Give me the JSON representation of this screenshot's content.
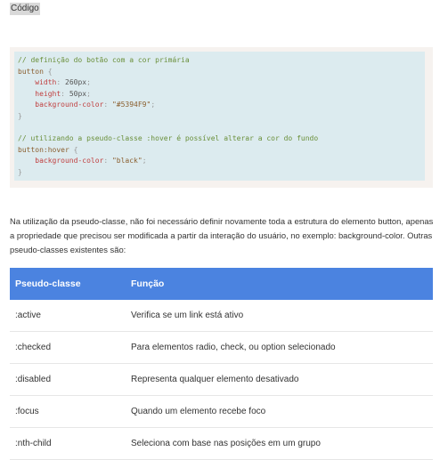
{
  "heading": "Código",
  "code": {
    "line1_comment": "// definição do botão com a cor primária",
    "line2_selector": "button",
    "line2_brace": " {",
    "line3_prop": "width",
    "line3_value": "260px",
    "line4_prop": "height",
    "line4_value": "50px",
    "line5_prop": "background-color",
    "line5_value": "\"#5394F9\"",
    "line6_close": "}",
    "line8_comment": "// utilizando a pseudo-classe :hover é possível alterar a cor do fundo",
    "line9_selector": "button:hover",
    "line9_brace": " {",
    "line10_prop": "background-color",
    "line10_value": "\"black\"",
    "line11_close": "}"
  },
  "paragraph": "Na utilização da pseudo-classe, não foi necessário definir novamente toda a estrutura do elemento button, apenas a propriedade que precisou ser modificada a partir da interação do usuário, no exemplo: background-color. Outras pseudo-classes existentes são:",
  "table": {
    "headers": [
      "Pseudo-classe",
      "Função"
    ],
    "rows": [
      [
        ":active",
        "Verifica se um link está ativo"
      ],
      [
        ":checked",
        "Para elementos radio, check, ou option selecionado"
      ],
      [
        ":disabled",
        "Representa qualquer elemento desativado"
      ],
      [
        ":focus",
        "Quando um elemento recebe foco"
      ],
      [
        ":nth-child",
        "Seleciona com base nas posições em um grupo"
      ]
    ]
  },
  "colors": {
    "table_header_bg": "#4b83e0",
    "code_bg": "#dcebef",
    "code_outer_bg": "#f6f2ef"
  }
}
